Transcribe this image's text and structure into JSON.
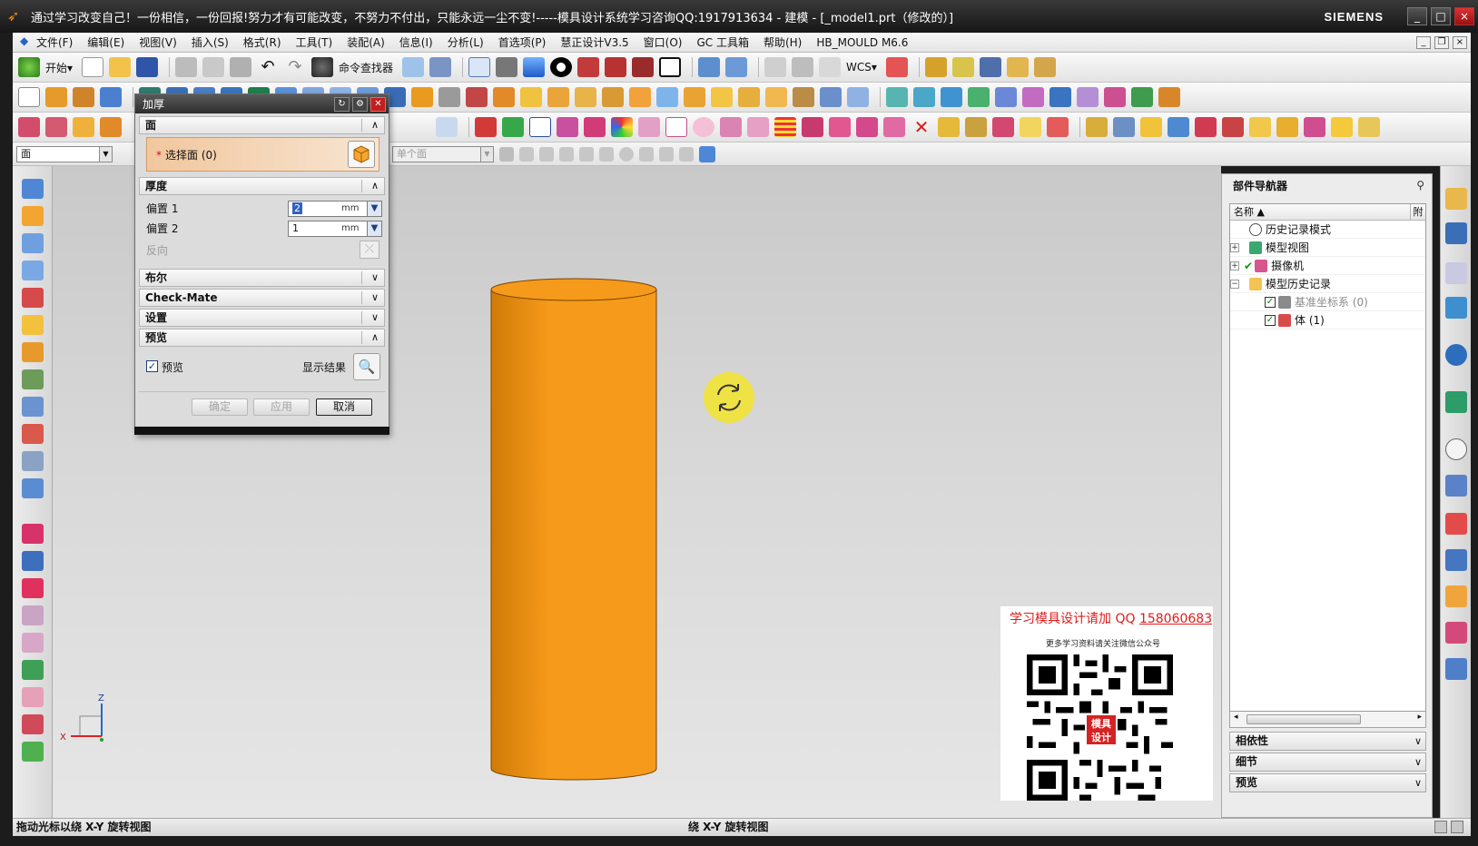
{
  "window": {
    "title": "通过学习改变自己！一份相信，一份回报!努力才有可能改变，不努力不付出，只能永远一尘不变!-----模具设计系统学习咨询QQ:1917913634 - 建模 - [_model1.prt（修改的）]",
    "brand": "SIEMENS",
    "min": "_",
    "max": "□",
    "close": "×"
  },
  "menubar": {
    "items": [
      "文件(F)",
      "编辑(E)",
      "视图(V)",
      "插入(S)",
      "格式(R)",
      "工具(T)",
      "装配(A)",
      "信息(I)",
      "分析(L)",
      "首选项(P)",
      "慧正设计V3.5",
      "窗口(O)",
      "GC 工具箱",
      "帮助(H)",
      "HB_MOULD M6.6"
    ]
  },
  "toolbar1": {
    "start_label": "开始▾",
    "command_finder_label": "命令查找器",
    "wcs_label": "WCS▾"
  },
  "selbar": {
    "filter_value": "面",
    "snap_value": "单个面"
  },
  "dialog": {
    "title": "加厚",
    "face_group": "面",
    "select_face_label": "选择面 (0)",
    "select_face_star": "*",
    "thickness_group": "厚度",
    "offset1_label": "偏置 1",
    "offset1_value": "2",
    "offset2_label": "偏置 2",
    "offset2_value": "1",
    "unit": "mm",
    "reverse_label": "反向",
    "boolean_group": "布尔",
    "checkmate_group": "Check-Mate",
    "settings_group": "设置",
    "preview_group": "预览",
    "preview_checkbox_label": "预览",
    "show_result_label": "显示结果",
    "ok_label": "确定",
    "apply_label": "应用",
    "cancel_label": "取消"
  },
  "navigator": {
    "title": "部件导航器",
    "col_name": "名称",
    "col_attach": "附",
    "items": [
      {
        "label": "历史记录模式",
        "expander": "",
        "muted": false
      },
      {
        "label": "模型视图",
        "expander": "+",
        "muted": false
      },
      {
        "label": "摄像机",
        "expander": "+",
        "muted": false
      },
      {
        "label": "模型历史记录",
        "expander": "−",
        "muted": false
      },
      {
        "label": "基准坐标系 (0)",
        "expander": "",
        "muted": true
      },
      {
        "label": "体 (1)",
        "expander": "",
        "muted": false
      }
    ],
    "sections": [
      "相依性",
      "细节",
      "预览"
    ]
  },
  "viewport": {
    "triad_z": "Z",
    "triad_x": "X",
    "cylinder_color": "#f59a1a",
    "cylinder_shadow": "#d07a08",
    "cursor_color": "#f2e334"
  },
  "promo": {
    "title_prefix": "学习模具设计请加 QQ ",
    "qq_number": "158060683",
    "subtitle": "更多学习资料请关注微信公众号",
    "badge": "模具设计"
  },
  "statusbar": {
    "left": "拖动光标以绕 X-Y 旋转视图",
    "middle": "绕 X-Y 旋转视图"
  }
}
